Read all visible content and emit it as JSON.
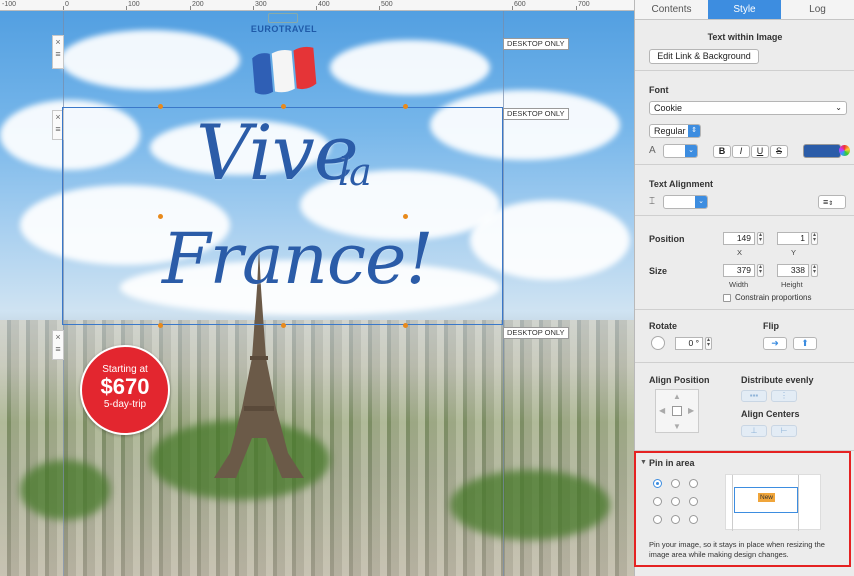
{
  "ruler": {
    "labels": [
      "-100",
      "0",
      "100",
      "200",
      "300",
      "400",
      "500",
      "600",
      "700"
    ]
  },
  "canvas": {
    "logo_text": "EUROTRAVEL",
    "desktop_only": "DESKTOP ONLY",
    "headline": {
      "word1": "Vive",
      "word2": "la",
      "word3": "France!"
    },
    "badge": {
      "line1": "Starting at",
      "price": "$670",
      "line3": "5-day-trip"
    },
    "colors": {
      "selection": "#3a78c9",
      "badge": "#e3262f",
      "headline": "#2b5ca8"
    }
  },
  "tabs": [
    {
      "label": "Contents",
      "active": false
    },
    {
      "label": "Style",
      "active": true
    },
    {
      "label": "Log",
      "active": false
    }
  ],
  "panel": {
    "text_within_image": "Text within Image",
    "edit_link_button": "Edit Link & Background",
    "font": {
      "title": "Font",
      "family": "Cookie",
      "weight": "Regular",
      "bold": "B",
      "italic": "I",
      "underline": "U",
      "strike": "S",
      "color": "#2b5ca8"
    },
    "alignment": {
      "title": "Text Alignment"
    },
    "position": {
      "title": "Position",
      "x": "149",
      "y": "1",
      "x_label": "X",
      "y_label": "Y"
    },
    "size": {
      "title": "Size",
      "width": "379",
      "height": "338",
      "width_label": "Width",
      "height_label": "Height",
      "constrain": "Constrain proportions"
    },
    "rotate": {
      "title": "Rotate",
      "value": "0 °"
    },
    "flip": {
      "title": "Flip"
    },
    "align_position": {
      "title": "Align Position"
    },
    "distribute": {
      "title": "Distribute evenly"
    },
    "align_centers": {
      "title": "Align Centers"
    },
    "pin": {
      "title": "Pin in area",
      "preview_label": "New",
      "description": "Pin your image, so it stays in place when resizing the image area while making design changes."
    }
  }
}
